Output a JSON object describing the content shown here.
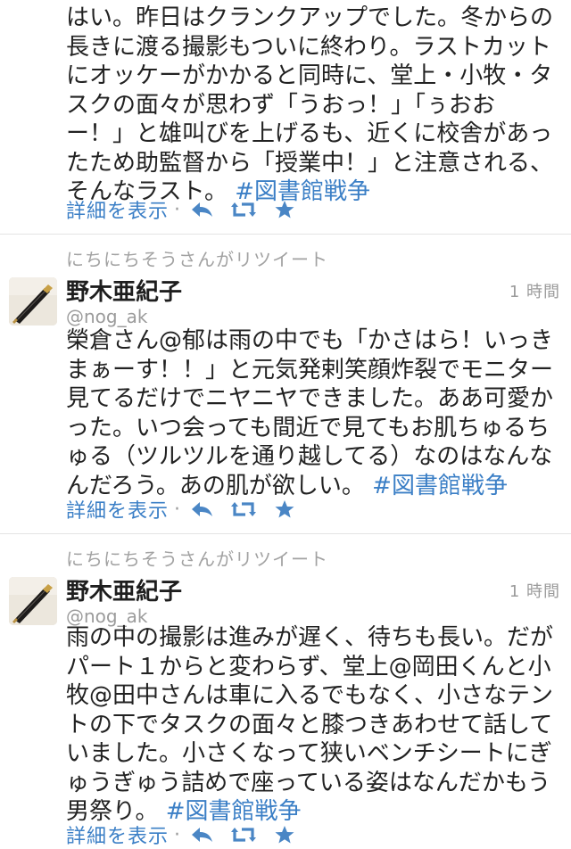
{
  "timeline": {
    "tweets": [
      {
        "lines": [
          "はい。昨日はクランクアップでした。冬からの",
          "長きに渡る撮影もついに終わり。ラストカット",
          "にオッケーがかかると同時に、堂上・小牧・タ",
          "スクの面々が思わず「うおっ！」「ぅおお",
          "ー！」と雄叫びを上げるも、近くに校舎があっ",
          "たため助監督から「授業中！」と注意される、",
          "そんなラスト。"
        ],
        "hashtag": "#図書館戦争",
        "details_label": "詳細を表示",
        "separator": "·"
      },
      {
        "retweet_line": "にちにちそうさんがリツイート",
        "author_name": "野木亜紀子",
        "screen_name": "@nog_ak",
        "time": "1 時間",
        "lines": [
          "榮倉さん@郁は雨の中でも「かさはら！いっき",
          "まぁーす！！」と元気発剌笑顔炸裂でモニター",
          "見てるだけでニヤニヤできました。ああ可愛か",
          "った。いつ会っても間近で見てもお肌ちゅるち",
          "ゅる（ツルツルを通り越してる）なのはなんな",
          "んだろう。あの肌が欲しい。"
        ],
        "hashtag": "#図書館戦争",
        "details_label": "詳細を表示",
        "separator": "·"
      },
      {
        "retweet_line": "にちにちそうさんがリツイート",
        "author_name": "野木亜紀子",
        "screen_name": "@nog_ak",
        "time": "1 時間",
        "lines": [
          "雨の中の撮影は進みが遅く、待ちも長い。だが",
          "パート１からと変わらず、堂上@岡田くんと小",
          "牧@田中さんは車に入るでもなく、小さなテン",
          "トの下でタスクの面々と膝つきあわせて話して",
          "いました。小さくなって狭いベンチシートにぎ",
          "ゅうぎゅう詰めで座っている姿はなんだかもう",
          "男祭り。"
        ],
        "hashtag": "#図書館戦争",
        "details_label": "詳細を表示",
        "separator": "·"
      }
    ]
  },
  "icons": {
    "reply": "reply-icon",
    "retweet": "retweet-icon",
    "favorite": "star-icon"
  },
  "colors": {
    "link": "#3b7fc6",
    "icon": "#4a86c5",
    "muted": "#9b9b9b",
    "text": "#222222"
  }
}
